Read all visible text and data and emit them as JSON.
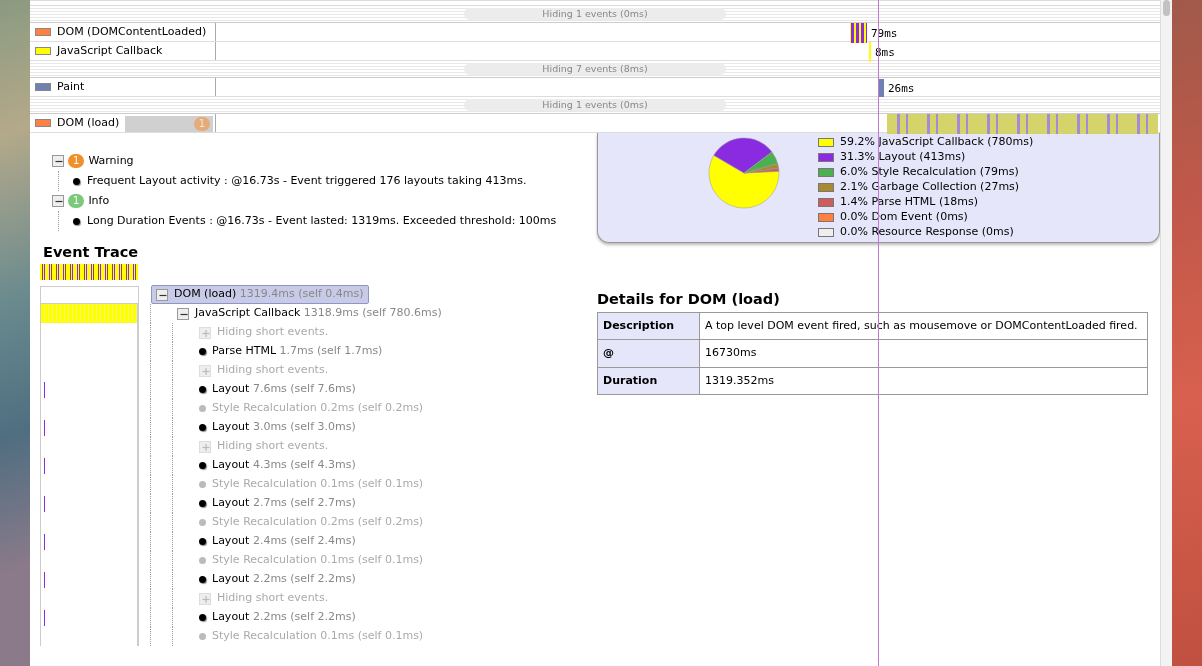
{
  "timeline": {
    "rows": [
      {
        "kind": "hidden",
        "label": "Hiding 1 events (0ms)"
      },
      {
        "kind": "event",
        "label": "DOM (DOMContentLoaded)",
        "color": "#ff8040",
        "duration": "79ms"
      },
      {
        "kind": "event",
        "label": "JavaScript Callback",
        "color": "#ffff00",
        "duration": "8ms"
      },
      {
        "kind": "hidden",
        "label": "Hiding 7 events (8ms)"
      },
      {
        "kind": "event",
        "label": "Paint",
        "color": "#7080b0",
        "duration": "26ms"
      },
      {
        "kind": "hidden",
        "label": "Hiding 1 events (0ms)"
      },
      {
        "kind": "event",
        "label": "DOM (load)",
        "color": "#ff8040",
        "badge": "1",
        "highlighted": true
      }
    ]
  },
  "notices": [
    {
      "kind": "warning",
      "count": "1",
      "title": "Warning",
      "expanded": true,
      "items": [
        "Frequent Layout activity : @16.73s - Event triggered 176 layouts taking 413ms."
      ]
    },
    {
      "kind": "info",
      "count": "1",
      "title": "Info",
      "expanded": true,
      "items": [
        "Long Duration Events : @16.73s - Event lasted: 1319ms. Exceeded threshold: 100ms"
      ]
    }
  ],
  "summary": {
    "chart_data": {
      "type": "pie",
      "categories": [
        "59.2% JavaScript Callback (780ms)",
        "31.3% Layout (413ms)",
        "6.0% Style Recalculation (79ms)",
        "2.1% Garbage Collection (27ms)",
        "1.4% Parse HTML (18ms)",
        "0.0% Dom Event (0ms)",
        "0.0% Resource Response (0ms)"
      ],
      "values": [
        59.2,
        31.3,
        6.0,
        2.1,
        1.4,
        0.0,
        0.0
      ]
    },
    "legend": [
      {
        "color": "#ffff00"
      },
      {
        "color": "#8a2be2"
      },
      {
        "color": "#4caf50"
      },
      {
        "color": "#a88a30"
      },
      {
        "color": "#cd5c5c"
      },
      {
        "color": "#ff8040"
      },
      {
        "color": "#eeeeee"
      }
    ]
  },
  "event_trace": {
    "title": "Event Trace",
    "tree": [
      {
        "kind": "event",
        "name": "DOM (load)",
        "duration": "1319.4ms",
        "self": "(self 0.4ms)",
        "selected": true,
        "expanded": true,
        "dimmed": false,
        "children": [
          {
            "kind": "event",
            "name": "JavaScript Callback",
            "duration": "1318.9ms",
            "self": "(self 780.6ms)",
            "selected": false,
            "expanded": true,
            "dimmed": false,
            "children": [
              {
                "kind": "hidden",
                "name": "Hiding short events."
              },
              {
                "kind": "event",
                "name": "Parse HTML",
                "duration": "1.7ms",
                "self": "(self 1.7ms)",
                "selected": false,
                "dimmed": false,
                "marked": false
              },
              {
                "kind": "hidden",
                "name": "Hiding short events."
              },
              {
                "kind": "event",
                "name": "Layout",
                "duration": "7.6ms",
                "self": "(self 7.6ms)",
                "selected": false,
                "dimmed": false,
                "marked": true
              },
              {
                "kind": "event",
                "name": "Style Recalculation",
                "duration": "0.2ms",
                "self": "(self 0.2ms)",
                "selected": false,
                "dimmed": true,
                "marked": false
              },
              {
                "kind": "event",
                "name": "Layout",
                "duration": "3.0ms",
                "self": "(self 3.0ms)",
                "selected": false,
                "dimmed": false,
                "marked": true
              },
              {
                "kind": "hidden",
                "name": "Hiding short events."
              },
              {
                "kind": "event",
                "name": "Layout",
                "duration": "4.3ms",
                "self": "(self 4.3ms)",
                "selected": false,
                "dimmed": false,
                "marked": true
              },
              {
                "kind": "event",
                "name": "Style Recalculation",
                "duration": "0.1ms",
                "self": "(self 0.1ms)",
                "selected": false,
                "dimmed": true,
                "marked": false
              },
              {
                "kind": "event",
                "name": "Layout",
                "duration": "2.7ms",
                "self": "(self 2.7ms)",
                "selected": false,
                "dimmed": false,
                "marked": true
              },
              {
                "kind": "event",
                "name": "Style Recalculation",
                "duration": "0.2ms",
                "self": "(self 0.2ms)",
                "selected": false,
                "dimmed": true,
                "marked": false
              },
              {
                "kind": "event",
                "name": "Layout",
                "duration": "2.4ms",
                "self": "(self 2.4ms)",
                "selected": false,
                "dimmed": false,
                "marked": true
              },
              {
                "kind": "event",
                "name": "Style Recalculation",
                "duration": "0.1ms",
                "self": "(self 0.1ms)",
                "selected": false,
                "dimmed": true,
                "marked": false
              },
              {
                "kind": "event",
                "name": "Layout",
                "duration": "2.2ms",
                "self": "(self 2.2ms)",
                "selected": false,
                "dimmed": false,
                "marked": true
              },
              {
                "kind": "hidden",
                "name": "Hiding short events."
              },
              {
                "kind": "event",
                "name": "Layout",
                "duration": "2.2ms",
                "self": "(self 2.2ms)",
                "selected": false,
                "dimmed": false,
                "marked": true
              },
              {
                "kind": "event",
                "name": "Style Recalculation",
                "duration": "0.1ms",
                "self": "(self 0.1ms)",
                "selected": false,
                "dimmed": true,
                "marked": false
              }
            ]
          }
        ]
      }
    ]
  },
  "details": {
    "title": "Details for DOM (load)",
    "rows": [
      {
        "label": "Description",
        "value": "A top level DOM event fired, such as mousemove or DOMContentLoaded fired."
      },
      {
        "label": "@",
        "value": "16730ms"
      },
      {
        "label": "Duration",
        "value": "1319.352ms"
      }
    ]
  }
}
